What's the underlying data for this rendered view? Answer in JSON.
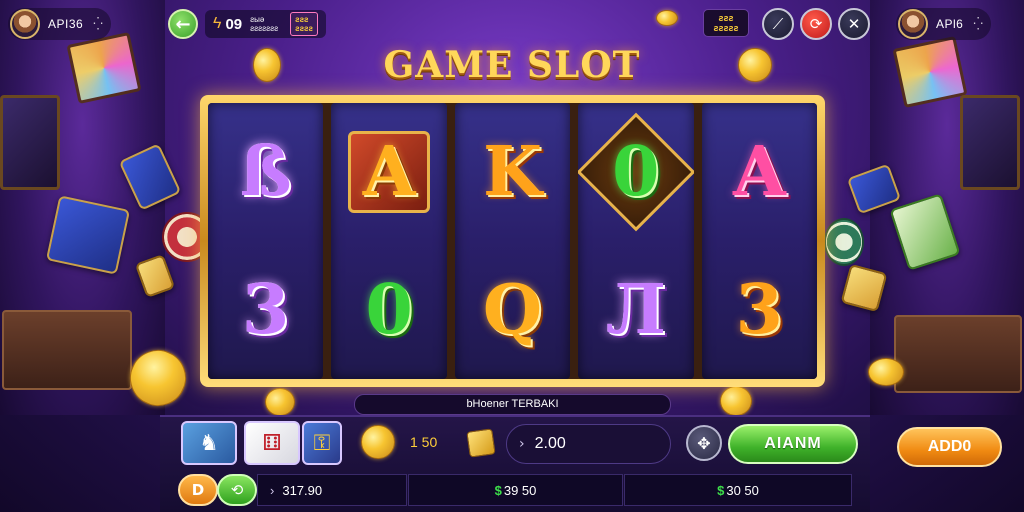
{
  "title": "GAME SLOT",
  "profile_left": {
    "name": "API36",
    "menu_icon": "dots-icon"
  },
  "profile_right": {
    "name": "APl6",
    "menu_icon": "dots-icon"
  },
  "hud": {
    "main_value": "09",
    "small_line1": "ƨыә",
    "small_line2": "ƨƨƨƨƨƨƨ",
    "badge_line1": "ƨƨƨ",
    "badge_line2": "ƨƨƨƨ"
  },
  "top_credits": {
    "line1": "ƨƨƨ",
    "line2": "ƨƨƨƨƨ"
  },
  "reels": [
    [
      "ß",
      "3"
    ],
    [
      "A",
      "0"
    ],
    [
      "K",
      "Q"
    ],
    [
      "0",
      "Л"
    ],
    [
      "A",
      "3"
    ]
  ],
  "banner_text": "bHoener TERBAKI",
  "coin_value": "1 50",
  "bet_value": "2.00",
  "spin_label": "AIANM",
  "add_label": "ADD0",
  "small_orange_label": "D",
  "stats": [
    {
      "prefix": "",
      "value": "317.90"
    },
    {
      "prefix": "$",
      "value": "39 50"
    },
    {
      "prefix": "$",
      "value": "30 50"
    }
  ],
  "colors": {
    "accent_gold": "#ffd75a",
    "spin_green": "#3fb22a",
    "add_orange": "#f08a12",
    "stat_green": "#3dde4a"
  }
}
